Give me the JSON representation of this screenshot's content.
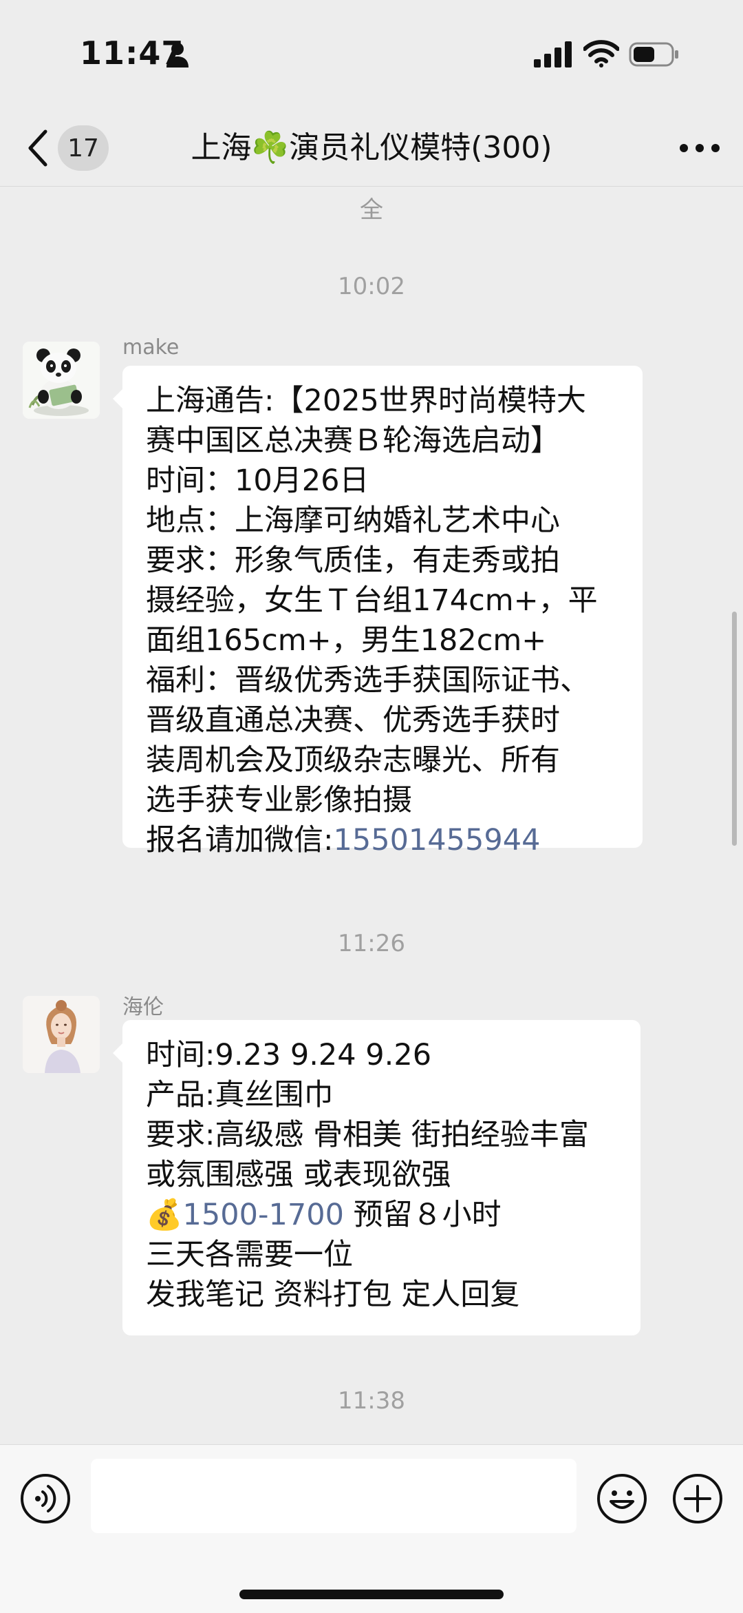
{
  "status_bar": {
    "time": "11:47",
    "icons": [
      "person-icon",
      "signal-icon",
      "wifi-icon",
      "battery-icon"
    ]
  },
  "nav": {
    "back_icon": "chevron-left-icon",
    "unread_count": "17",
    "title": "上海☘️演员礼仪模特(300)",
    "more_icon": "ellipsis-icon"
  },
  "cut_off_text": "全",
  "messages": [
    {
      "timestamp": "10:02",
      "sender": "make",
      "avatar": "panda-avatar",
      "lines": [
        "上海通告:【2025世界时尚模特大",
        "赛中国区总决赛Ｂ轮海选启动】",
        "时间：10月26日",
        "地点：上海摩可纳婚礼艺术中心",
        "要求：形象气质佳，有走秀或拍",
        "摄经验，女生Ｔ台组174cm+，平",
        "面组165cm+，男生182cm+",
        "福利：晋级优秀选手获国际证书、",
        "晋级直通总决赛、优秀选手获时",
        "装周机会及顶级杂志曝光、所有",
        "选手获专业影像拍摄"
      ],
      "contact_label": "报名请加微信:",
      "contact_phone": "15501455944"
    },
    {
      "timestamp": "11:26",
      "sender": "海伦",
      "avatar": "woman-portrait-avatar",
      "lines_top": [
        "时间:9.23 9.24 9.26",
        "产品:真丝围巾",
        "要求:高级感 骨相美 街拍经验丰富",
        "或氛围感强 或表现欲强"
      ],
      "price_emoji": "💰",
      "price": "1500-1700",
      "price_suffix": " 预留８小时",
      "lines_bottom": [
        "三天各需要一位",
        "发我笔记 资料打包 定人回复"
      ]
    }
  ],
  "last_timestamp": "11:38",
  "input_bar": {
    "voice_icon": "voice-icon",
    "input_value": "",
    "emoji_icon": "smiley-icon",
    "plus_icon": "plus-icon"
  }
}
